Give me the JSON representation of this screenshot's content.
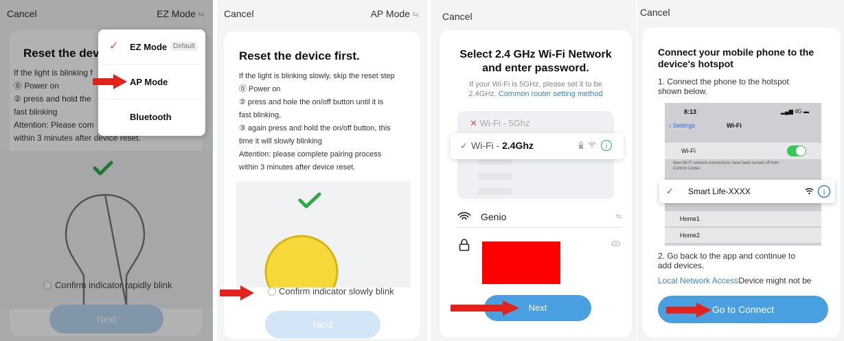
{
  "panel1": {
    "cancel": "Cancel",
    "mode": "EZ Mode",
    "mode_swap": "⇋",
    "title": "Reset the devi",
    "lines": [
      "If the light is blinking f",
      "⓪ Power on",
      "② press and hold the",
      "fast blinking",
      "Attention: Please com",
      "within 3 minutes after device reset."
    ],
    "confirm": "Confirm indicator rapidly blink",
    "next": "Next",
    "menu": [
      {
        "label": "EZ Mode",
        "badge": "Default",
        "checked": true
      },
      {
        "label": "AP Mode",
        "badge": "",
        "checked": false
      },
      {
        "label": "Bluetooth",
        "badge": "",
        "checked": false
      }
    ]
  },
  "panel2": {
    "cancel": "Cancel",
    "mode": "AP Mode",
    "mode_swap": "⇋",
    "title": "Reset the device first.",
    "lines": [
      "If the light is blinking slowly, skip the reset step",
      "⓪ Power on",
      "② press and hole the on/off button until it is",
      "fast blinking,",
      "③ again press and hold the on/off button, this",
      "time it will slowly blinking",
      "Attention: please complete pairing process",
      "within 3 minutes after device reset."
    ],
    "confirm": "Confirm indicator slowly blink",
    "next": "Next"
  },
  "panel3": {
    "cancel": "Cancel",
    "title_line1": "Select 2.4 GHz Wi-Fi Network",
    "title_line2": "and enter password.",
    "sub_line1": "If your Wi-Fi is 5GHz, please set it to be",
    "sub_line2_prefix": "2.4GHz.",
    "sub_link": "Common router setting method",
    "wifi_5g_prefix": "Wi-Fi - ",
    "wifi_5g": "5Ghz",
    "wifi_24_prefix": "Wi-Fi - ",
    "wifi_24": "2.4Ghz",
    "network": "Genio",
    "next": "Next"
  },
  "panel4": {
    "cancel": "Cancel",
    "title_line1": "Connect your mobile phone to the",
    "title_line2": "device's hotspot",
    "step1_line1": "1. Connect the phone to the hotspot",
    "step1_line2": "shown below.",
    "phone_time": "8:13",
    "phone_signal": "4G",
    "phone_back": "Settings",
    "phone_header": "Wi-Fi",
    "phone_wifi": "Wi-Fi",
    "phone_note_line1": "New Wi-Fi network connections have been turned off from",
    "phone_note_line2": "Control Center.",
    "hotspot": "Smart Life-XXXX",
    "home1": "Home1",
    "home2": "Home2",
    "step2_line1": "2. Go back to the app and continue to",
    "step2_line2": "add devices.",
    "link": "Local Network Access",
    "link_rest": "Device might not be",
    "connect": "Go to Connect"
  },
  "colors": {
    "accent": "#e3503e",
    "blue": "#4a9fe0",
    "link": "#3a86c8",
    "green": "#2ea84a",
    "arrow_red": "#e3221b"
  }
}
